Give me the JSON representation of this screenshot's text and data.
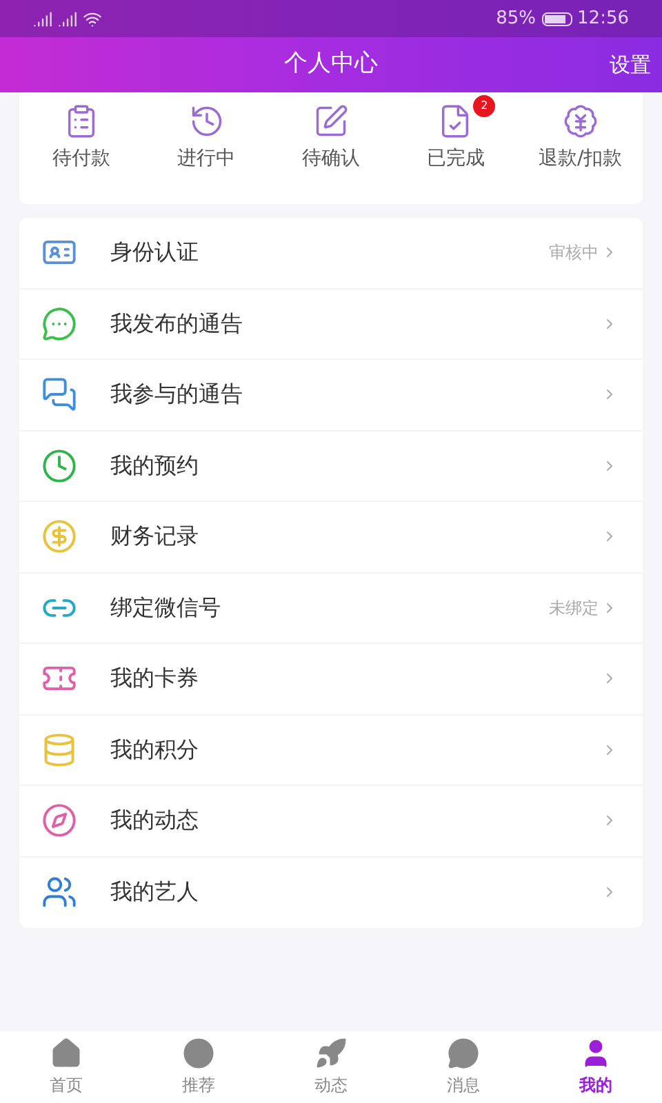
{
  "status_bar": {
    "battery": "85%",
    "time": "12:56"
  },
  "header": {
    "title": "个人中心",
    "settings": "设置"
  },
  "orders": [
    {
      "label": "待付款"
    },
    {
      "label": "进行中"
    },
    {
      "label": "待确认"
    },
    {
      "label": "已完成",
      "badge": "2"
    },
    {
      "label": "退款/扣款"
    }
  ],
  "menu": [
    {
      "label": "身份认证",
      "value": "审核中"
    },
    {
      "label": "我发布的通告"
    },
    {
      "label": "我参与的通告"
    },
    {
      "label": "我的预约"
    },
    {
      "label": "财务记录"
    },
    {
      "label": "绑定微信号",
      "value": "未绑定"
    },
    {
      "label": "我的卡券"
    },
    {
      "label": "我的积分"
    },
    {
      "label": "我的动态"
    },
    {
      "label": "我的艺人"
    }
  ],
  "tabs": [
    {
      "label": "首页",
      "selected": false
    },
    {
      "label": "推荐",
      "selected": false
    },
    {
      "label": "动态",
      "selected": false
    },
    {
      "label": "消息",
      "selected": false
    },
    {
      "label": "我的",
      "selected": true
    }
  ]
}
